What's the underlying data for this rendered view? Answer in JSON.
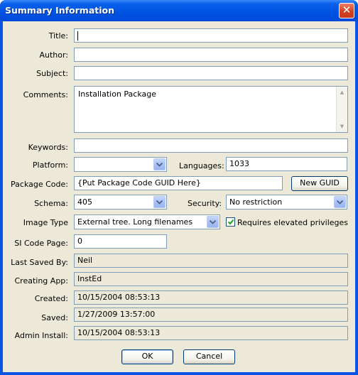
{
  "window": {
    "title": "Summary Information",
    "close_glyph": "✕"
  },
  "fields": {
    "title": {
      "label": "Title:",
      "value": ""
    },
    "author": {
      "label": "Author:",
      "value": ""
    },
    "subject": {
      "label": "Subject:",
      "value": ""
    },
    "comments": {
      "label": "Comments:",
      "value": "Installation Package"
    },
    "keywords": {
      "label": "Keywords:",
      "value": ""
    },
    "platform": {
      "label": "Platform:",
      "value": ""
    },
    "languages": {
      "label": "Languages:",
      "value": "1033"
    },
    "package_code": {
      "label": "Package Code:",
      "value": "{Put Package Code GUID Here}"
    },
    "schema": {
      "label": "Schema:",
      "value": "405"
    },
    "security": {
      "label": "Security:",
      "value": "No restriction"
    },
    "image_type": {
      "label": "Image Type",
      "value": "External tree. Long filenames"
    },
    "elevated": {
      "label": "Requires elevated privileges",
      "checked": true
    },
    "si_code_page": {
      "label": "SI Code Page:",
      "value": "0"
    },
    "last_saved_by": {
      "label": "Last Saved By:",
      "value": "Neil"
    },
    "creating_app": {
      "label": "Creating App:",
      "value": "InstEd"
    },
    "created": {
      "label": "Created:",
      "value": "10/15/2004 08:53:13"
    },
    "saved": {
      "label": "Saved:",
      "value": "1/27/2009 13:57:00"
    },
    "admin_install": {
      "label": "Admin Install:",
      "value": "10/15/2004 08:53:13"
    }
  },
  "buttons": {
    "new_guid": "New GUID",
    "ok": "OK",
    "cancel": "Cancel"
  },
  "colors": {
    "titlebar": "#0054e3",
    "dialog_bg": "#ece9d8",
    "close_button": "#d6401f",
    "field_border": "#7f9db9"
  }
}
